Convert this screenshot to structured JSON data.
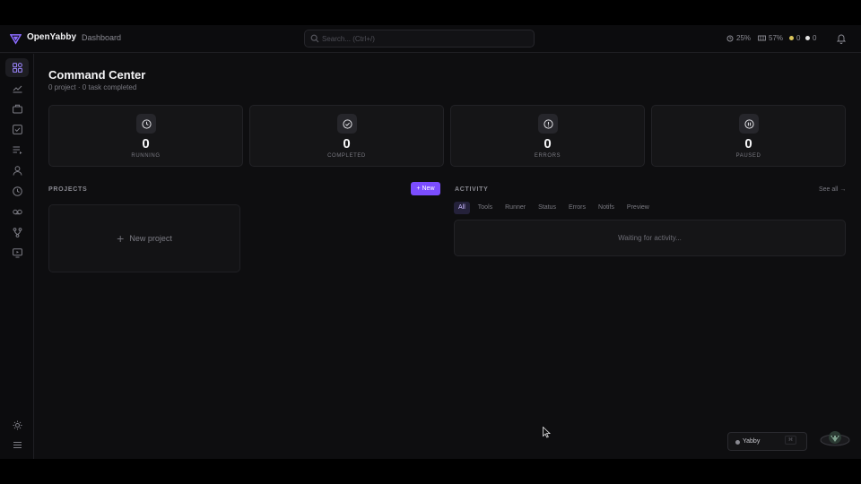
{
  "topbar": {
    "brand": "OpenYabby",
    "breadcrumb": "Dashboard",
    "search_placeholder": "Search... (Ctrl+/)",
    "cpu": "25%",
    "memory": "57%",
    "count_a": "0",
    "count_b": "0"
  },
  "sidebar": {
    "items": [
      "dashboard",
      "analytics",
      "briefcase",
      "tasks",
      "queue",
      "agents",
      "history",
      "voice",
      "git",
      "presentation"
    ],
    "bottom": [
      "theme-toggle",
      "menu"
    ]
  },
  "page": {
    "title": "Command Center",
    "subtitle": "0 project · 0 task completed"
  },
  "cards": [
    {
      "value": "0",
      "label": "RUNNING",
      "icon": "clock-icon"
    },
    {
      "value": "0",
      "label": "COMPLETED",
      "icon": "check-circle-icon"
    },
    {
      "value": "0",
      "label": "ERRORS",
      "icon": "alert-icon"
    },
    {
      "value": "0",
      "label": "PAUSED",
      "icon": "pause-icon"
    }
  ],
  "projects": {
    "label": "PROJECTS",
    "new_button": "+ New",
    "new_project": "New project"
  },
  "activity": {
    "label": "ACTIVITY",
    "see_all": "See all →",
    "tabs": [
      "All",
      "Tools",
      "Runner",
      "Status",
      "Errors",
      "Notifs",
      "Preview"
    ],
    "active_tab": "All",
    "empty": "Waiting for activity..."
  },
  "widget": {
    "name": "Yabby",
    "shortcut": "⌘"
  },
  "colors": {
    "accent": "#7b4dff",
    "background": "#0e0e10",
    "card": "#151517",
    "status_dot_a": "#d9c45a",
    "status_dot_b": "#e6e6e6"
  }
}
